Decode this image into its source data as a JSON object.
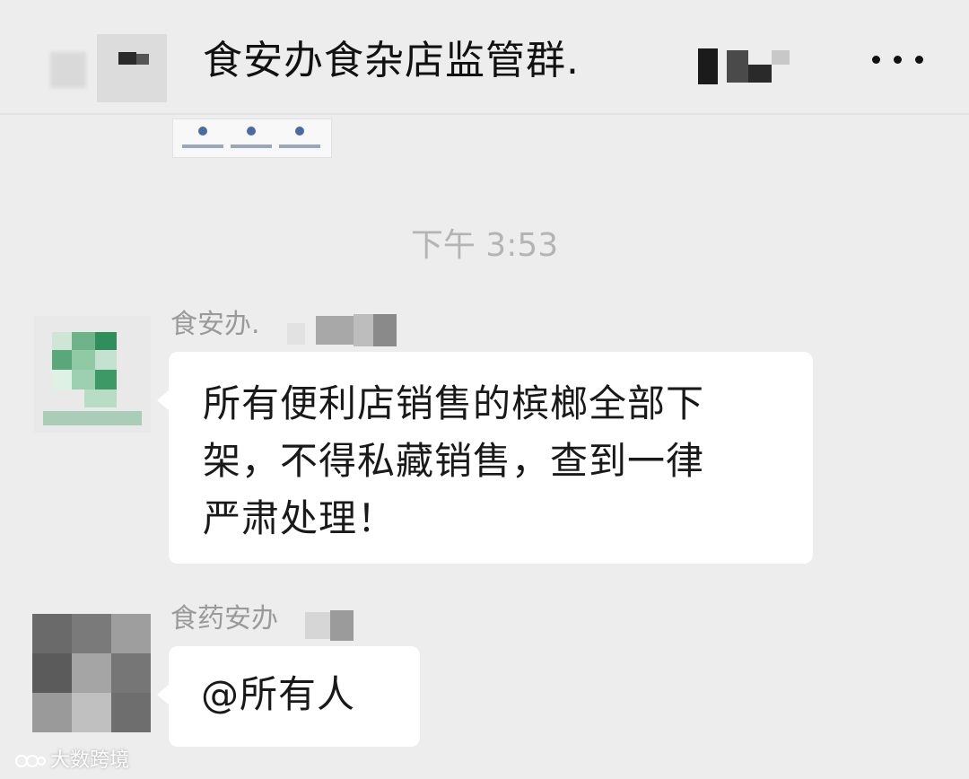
{
  "header": {
    "title": "食安办食杂店监管群.",
    "more_icon": "more-dots-icon"
  },
  "chat": {
    "timestamp": "下午 3:53",
    "messages": [
      {
        "sender": "食安办.",
        "lines": [
          "所有便利店销售的槟榔全部下",
          "架，不得私藏销售，查到一律",
          "严肃处理！"
        ]
      },
      {
        "sender": "食药安办",
        "lines": [
          "@所有人"
        ]
      }
    ]
  },
  "watermark": {
    "text": "大数跨境"
  },
  "colors": {
    "background": "#ededed",
    "bubble": "#ffffff",
    "timestamp": "#b4b4b4",
    "sender": "#9a9a9a"
  }
}
